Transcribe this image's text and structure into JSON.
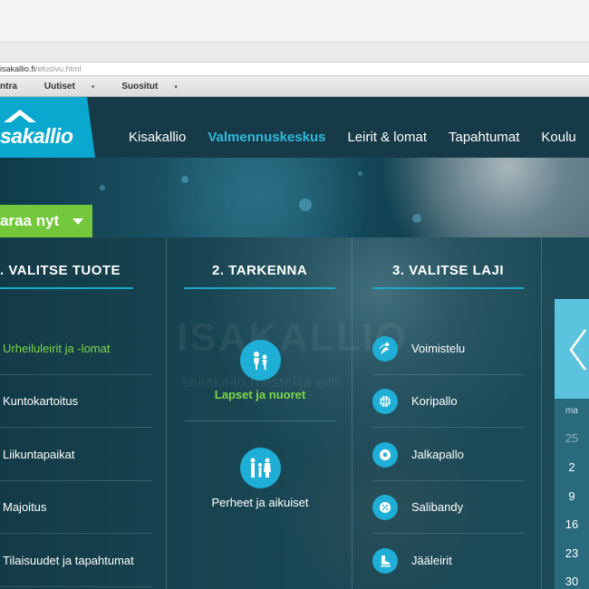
{
  "browser": {
    "address_host": "isakallio.fi",
    "address_path": "/etusivu.html",
    "bookmarks": [
      {
        "label": "ntra",
        "caret": ""
      },
      {
        "label": "Uutiset",
        "caret": "▾"
      },
      {
        "label": "Suositut",
        "caret": "▾"
      }
    ]
  },
  "site": {
    "logo_text": "sakallio",
    "nav": [
      "Kisakallio",
      "Valmennuskeskus",
      "Leirit & lomat",
      "Tapahtumat",
      "Koulu"
    ],
    "nav_active_index": 1,
    "cta_label": "araa nyt",
    "watermark": "ISAKALLIO",
    "watermark_sub": "seitakeito mestelija eito",
    "col1_title": ". VALITSE TUOTE",
    "col2_title": "2. TARKENNA",
    "col3_title": "3. VALITSE LAJI",
    "products": [
      {
        "label": "Urheiluleirit  ja -lomat",
        "highlighted": true
      },
      {
        "label": "Kuntokartoitus",
        "highlighted": false
      },
      {
        "label": "Liikuntapaikat",
        "highlighted": false
      },
      {
        "label": "Majoitus",
        "highlighted": false
      },
      {
        "label": "Tilaisuudet ja tapahtumat",
        "highlighted": false
      }
    ],
    "refine": [
      {
        "label": "Lapset ja nuoret",
        "icon": "kids-icon",
        "highlighted": true
      },
      {
        "label": "Perheet ja aikuiset",
        "icon": "family-icon",
        "highlighted": false
      }
    ],
    "sports": [
      {
        "label": "Voimistelu",
        "icon": "gymnastics-icon"
      },
      {
        "label": "Koripallo",
        "icon": "basketball-icon"
      },
      {
        "label": "Jalkapallo",
        "icon": "soccer-icon"
      },
      {
        "label": "Salibandy",
        "icon": "floorball-icon"
      },
      {
        "label": "Jääleirit",
        "icon": "skate-icon"
      }
    ],
    "calendar": {
      "weekday": "ma",
      "days": [
        "25",
        "2",
        "9",
        "16",
        "23",
        "30"
      ]
    },
    "colors": {
      "accent": "#1faed5",
      "green": "#7fd64a",
      "header_bg": "#163a47",
      "logo_bg": "#0aa8cf"
    }
  }
}
